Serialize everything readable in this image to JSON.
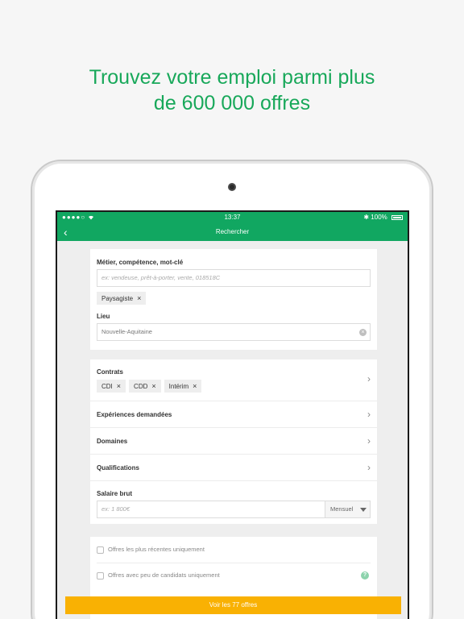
{
  "headline": {
    "line1": "Trouvez votre emploi parmi plus",
    "line2": "de 600 000 offres"
  },
  "status_bar": {
    "signal": "●●●●○",
    "wifi": "wifi-icon",
    "time": "13:37",
    "bluetooth": "✱",
    "battery": "100%"
  },
  "nav": {
    "back_icon": "‹",
    "title": "Rechercher"
  },
  "search": {
    "job_label": "Métier, compétence, mot-clé",
    "job_placeholder": "ex: vendeuse, prêt-à-porter, vente, 018518C",
    "job_chip": "Paysagiste",
    "location_label": "Lieu",
    "location_value": "Nouvelle-Aquitaine"
  },
  "filters": {
    "contracts_label": "Contrats",
    "contracts": [
      "CDI",
      "CDD",
      "Intérim"
    ],
    "experience_label": "Expériences demandées",
    "domains_label": "Domaines",
    "qualifications_label": "Qualifications",
    "salary_label": "Salaire brut",
    "salary_placeholder": "ex: 1 800€",
    "salary_period": "Mensuel"
  },
  "options": {
    "recent_only": "Offres les plus récentes uniquement",
    "few_candidates_only": "Offres avec peu de candidats uniquement",
    "help": "?"
  },
  "cta": {
    "label": "Voir les 77 offres"
  },
  "colors": {
    "brand_green": "#11a761",
    "headline_green": "#18a85a",
    "cta_yellow": "#f9b103"
  }
}
